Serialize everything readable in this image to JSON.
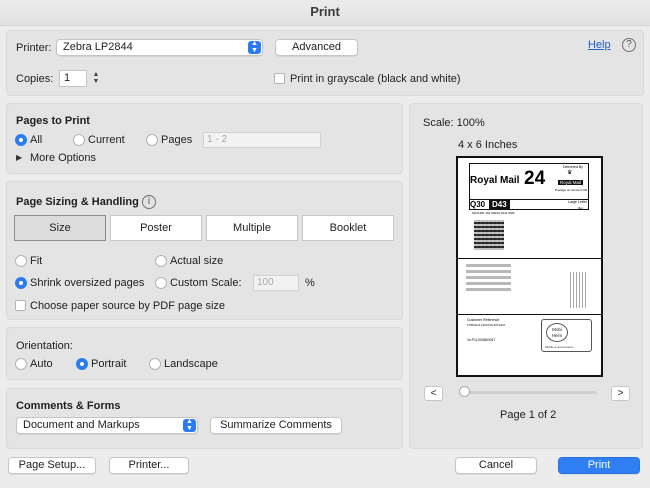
{
  "window": {
    "title": "Print"
  },
  "printer": {
    "label": "Printer:",
    "value": "Zebra LP2844",
    "advanced_label": "Advanced",
    "help_label": "Help",
    "help_icon": "?"
  },
  "copies": {
    "label": "Copies:",
    "value": "1",
    "grayscale_label": "Print in grayscale (black and white)"
  },
  "pages": {
    "heading": "Pages to Print",
    "all_label": "All",
    "current_label": "Current",
    "pages_label": "Pages",
    "range_placeholder": "1 - 2",
    "more_options_label": "More Options"
  },
  "sizing": {
    "heading": "Page Sizing & Handling",
    "tabs": [
      "Size",
      "Poster",
      "Multiple",
      "Booklet"
    ],
    "selected_tab": "Size",
    "fit_label": "Fit",
    "actual_size_label": "Actual size",
    "shrink_label": "Shrink oversized pages",
    "custom_scale_label": "Custom Scale:",
    "scale_placeholder": "100",
    "scale_unit": "%",
    "paper_source_label": "Choose paper source by PDF page size"
  },
  "orientation": {
    "heading": "Orientation:",
    "auto_label": "Auto",
    "portrait_label": "Portrait",
    "landscape_label": "Landscape",
    "selected": "Portrait"
  },
  "comments": {
    "heading": "Comments & Forms",
    "value": "Document and Markups",
    "summarize_label": "Summarize Comments"
  },
  "preview": {
    "scale_text": "Scale: 100%",
    "paper_size": "4 x 6 Inches",
    "prev_label": "<",
    "next_label": ">",
    "page_text": "Page 1 of 2",
    "slider_position": 0,
    "label": {
      "brand": "Royal Mail",
      "service_number": "24",
      "delivered_by": "Delivered By",
      "logo_text": "Royal Mail",
      "postage_text": "Postage on Account GB",
      "code_a": "Q30",
      "code_b": "D43",
      "size_class": "Large Letter",
      "weight": "0kg",
      "tracking": "SD41481 164 6003H 2241 8GB",
      "customer_ref_label": "Customer Reference",
      "customer_ref": "1789/11/4-1103720-4071347",
      "footer_ref": "1s P1L003840047",
      "badge_top": "Mobi",
      "badge_bottom": "Heim",
      "badge_caption": "Mobile & accessories"
    }
  },
  "footer": {
    "page_setup_label": "Page Setup...",
    "printer_label": "Printer...",
    "cancel_label": "Cancel",
    "print_label": "Print"
  },
  "colors": {
    "accent": "#2b7cf0",
    "link": "#2060d0"
  }
}
